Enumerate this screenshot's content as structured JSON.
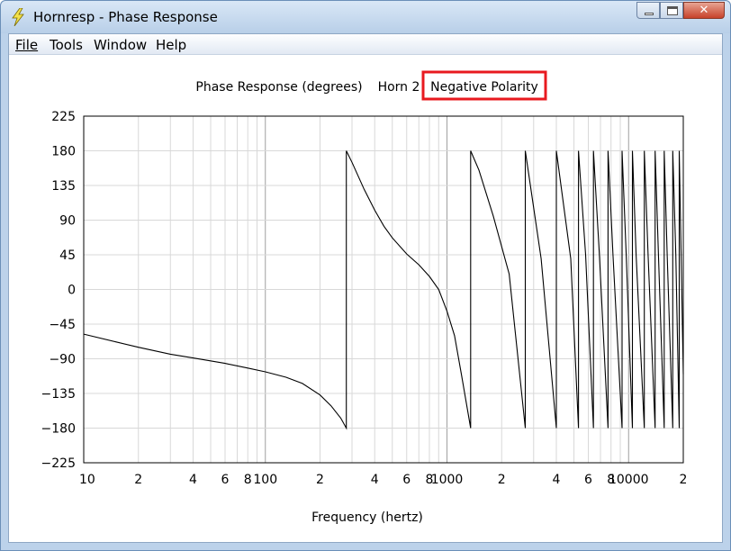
{
  "window": {
    "title": "Hornresp - Phase Response"
  },
  "menu": {
    "items": [
      "File",
      "Tools",
      "Window",
      "Help"
    ]
  },
  "header": {
    "title": "Phase Response (degrees)",
    "horn": "Horn 2",
    "highlight": "Negative Polarity"
  },
  "colors": {
    "highlight_border": "#e8191f",
    "grid": "#d8d8d8",
    "grid_major": "#a0a0a0",
    "curve": "#000000"
  },
  "chart_data": {
    "type": "line",
    "title": "Phase Response (degrees)",
    "xlabel": "Frequency (hertz)",
    "ylabel": "",
    "xscale": "log",
    "xlim": [
      10,
      20000
    ],
    "ylim": [
      -225,
      225
    ],
    "y_ticks": [
      225,
      180,
      135,
      90,
      45,
      0,
      -45,
      -90,
      -135,
      -180,
      -225
    ],
    "x_tick_labels": [
      {
        "x": 10,
        "label": "10"
      },
      {
        "x": 20,
        "label": "2"
      },
      {
        "x": 40,
        "label": "4"
      },
      {
        "x": 60,
        "label": "6"
      },
      {
        "x": 80,
        "label": "8"
      },
      {
        "x": 100,
        "label": "100"
      },
      {
        "x": 200,
        "label": "2"
      },
      {
        "x": 400,
        "label": "4"
      },
      {
        "x": 600,
        "label": "6"
      },
      {
        "x": 800,
        "label": "8"
      },
      {
        "x": 1000,
        "label": "1000"
      },
      {
        "x": 2000,
        "label": "2"
      },
      {
        "x": 4000,
        "label": "4"
      },
      {
        "x": 6000,
        "label": "6"
      },
      {
        "x": 8000,
        "label": "8"
      },
      {
        "x": 10000,
        "label": "10000"
      },
      {
        "x": 20000,
        "label": "2"
      }
    ],
    "grid": true,
    "series": [
      {
        "x": [
          10,
          15,
          20,
          30,
          40,
          60,
          80,
          100,
          130,
          160,
          200,
          230,
          260,
          279,
          279,
          300,
          350,
          400,
          450,
          500,
          600,
          700,
          800,
          900,
          1000,
          1100,
          1200,
          1350,
          1350,
          1500,
          1800,
          2200,
          2700,
          2700,
          3300,
          4000,
          4000,
          4800,
          5300,
          5300,
          5800,
          6400,
          6400,
          6900,
          7700,
          7700,
          8200,
          9200,
          9200,
          9700,
          10500,
          10500,
          11000,
          12200,
          12200,
          12800,
          14000,
          14000,
          14600,
          15700,
          15700,
          16300,
          17500,
          17500,
          18200,
          19000,
          19000,
          20000
        ],
        "y": [
          -58,
          -68,
          -75,
          -84,
          -89,
          -96,
          -102,
          -107,
          -114,
          -122,
          -137,
          -151,
          -167,
          -180,
          180,
          165,
          130,
          103,
          82,
          67,
          46,
          32,
          17,
          0,
          -28,
          -60,
          -110,
          -180,
          180,
          155,
          95,
          20,
          -180,
          180,
          40,
          -180,
          180,
          40,
          -180,
          180,
          45,
          -180,
          180,
          45,
          -180,
          180,
          45,
          -180,
          180,
          45,
          -180,
          180,
          45,
          -180,
          180,
          45,
          -180,
          180,
          45,
          -180,
          180,
          45,
          -180,
          180,
          45,
          -180,
          180,
          -110
        ]
      }
    ]
  }
}
